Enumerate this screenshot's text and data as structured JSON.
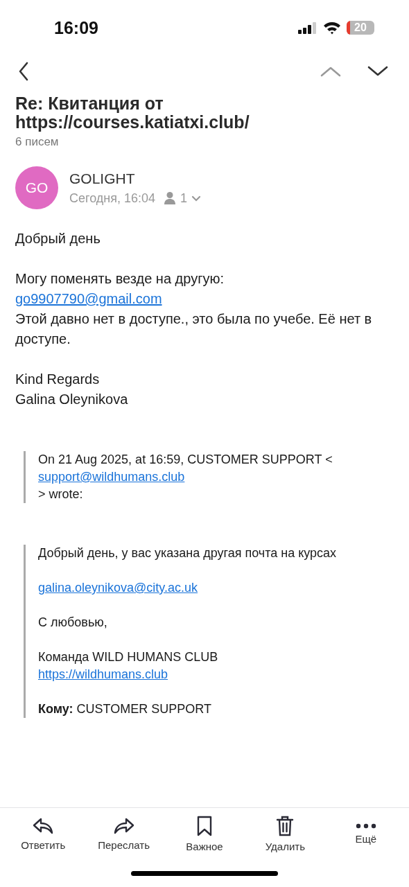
{
  "status_bar": {
    "time": "16:09",
    "battery": "20"
  },
  "subject": "Re: Квитанция от https://courses.katiatxi.club/",
  "message_count": "6 писем",
  "sender": {
    "initials": "GO",
    "name": "GOLIGHT",
    "date": "Сегодня, 16:04",
    "recipients": "1"
  },
  "body": [
    {
      "lines": [
        {
          "kind": "text",
          "text": "Добрый день"
        }
      ]
    },
    {
      "lines": [
        {
          "kind": "text",
          "text": "Могу поменять везде на другую:"
        },
        {
          "kind": "link",
          "text": "go9907790@gmail.com"
        },
        {
          "kind": "text",
          "text": "Этой давно нет в доступе., это была по учебе. Её нет в доступе."
        }
      ]
    },
    {
      "lines": [
        {
          "kind": "text",
          "text": "Kind Regards"
        },
        {
          "kind": "text",
          "text": "Galina Oleynikova"
        }
      ]
    }
  ],
  "quotes": [
    {
      "paragraphs": [
        {
          "lines": [
            {
              "kind": "text",
              "text": "On 21 Aug 2025, at 16:59, CUSTOMER SUPPORT <"
            },
            {
              "kind": "link",
              "text": "support@wildhumans.club"
            },
            {
              "kind": "text",
              "text": "> wrote:"
            }
          ]
        }
      ]
    },
    {
      "paragraphs": [
        {
          "lines": [
            {
              "kind": "text",
              "text": "Добрый день, у вас указана другая почта на курсах"
            }
          ]
        },
        {
          "lines": [
            {
              "kind": "link",
              "text": "galina.oleynikova@city.ac.uk"
            }
          ]
        },
        {
          "lines": [
            {
              "kind": "text",
              "text": "С любовью,"
            }
          ]
        },
        {
          "lines": [
            {
              "kind": "text",
              "text": "Команда WILD HUMANS CLUB"
            },
            {
              "kind": "link",
              "text": "https://wildhumans.club"
            }
          ]
        },
        {
          "lines": [
            {
              "kind": "text",
              "text": "**Кому:** CUSTOMER SUPPORT"
            }
          ]
        }
      ]
    }
  ],
  "toolbar": [
    {
      "kind": "reply",
      "label": "Ответить"
    },
    {
      "kind": "forward",
      "label": "Переслать"
    },
    {
      "kind": "bookmark",
      "label": "Важное"
    },
    {
      "kind": "delete",
      "label": "Удалить"
    },
    {
      "kind": "more",
      "label": "Ещё"
    }
  ]
}
